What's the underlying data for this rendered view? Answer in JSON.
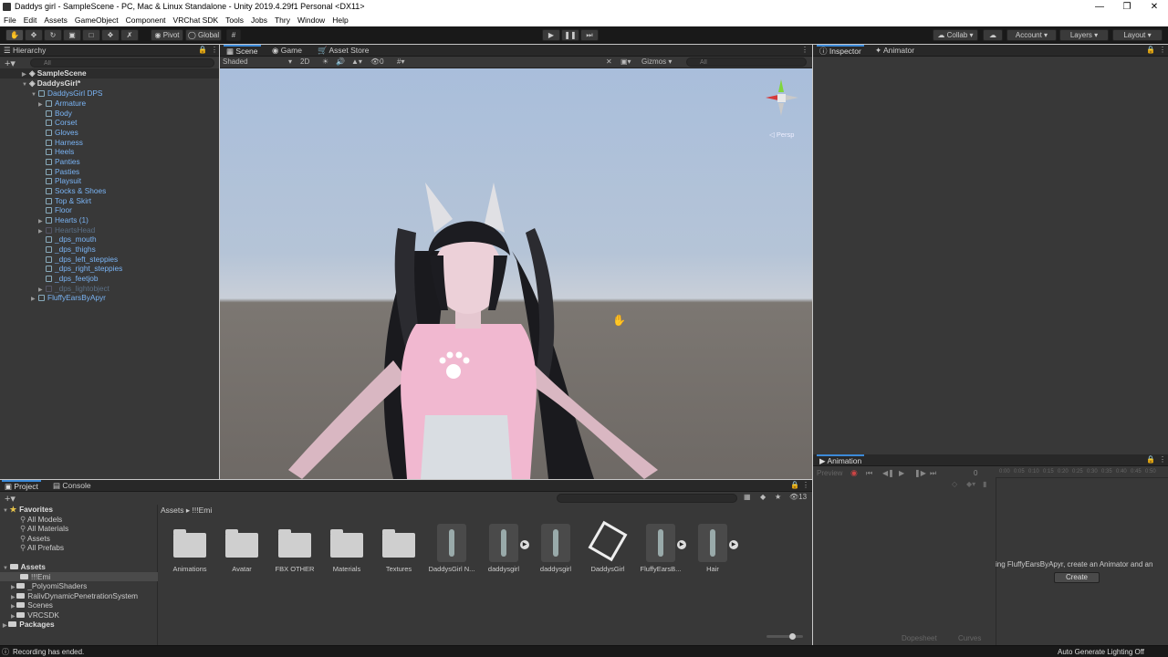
{
  "titlebar": {
    "title": "Daddys girl - SampleScene - PC, Mac & Linux Standalone - Unity 2019.4.29f1 Personal <DX11>"
  },
  "menu": [
    "File",
    "Edit",
    "Assets",
    "GameObject",
    "Component",
    "VRChat SDK",
    "Tools",
    "Jobs",
    "Thry",
    "Window",
    "Help"
  ],
  "toolbar": {
    "pivot": "Pivot",
    "global": "Global",
    "collab": "Collab",
    "account": "Account",
    "layers": "Layers",
    "layout": "Layout"
  },
  "hierarchy": {
    "tab": "Hierarchy",
    "search_placeholder": "All",
    "items": [
      {
        "label": "SampleScene",
        "type": "scene"
      },
      {
        "label": "DaddysGirl*",
        "type": "scene"
      },
      {
        "label": "DaddysGirl DPS",
        "type": "obj"
      },
      {
        "label": "Armature",
        "type": "obj"
      },
      {
        "label": "Body",
        "type": "obj"
      },
      {
        "label": "Corset",
        "type": "obj"
      },
      {
        "label": "Gloves",
        "type": "obj"
      },
      {
        "label": "Harness",
        "type": "obj"
      },
      {
        "label": "Heels",
        "type": "obj"
      },
      {
        "label": "Panties",
        "type": "obj"
      },
      {
        "label": "Pasties",
        "type": "obj"
      },
      {
        "label": "Playsuit",
        "type": "obj"
      },
      {
        "label": "Socks & Shoes",
        "type": "obj"
      },
      {
        "label": "Top & Skirt",
        "type": "obj"
      },
      {
        "label": "Floor",
        "type": "obj"
      },
      {
        "label": "Hearts (1)",
        "type": "obj"
      },
      {
        "label": "HeartsHead",
        "type": "dim"
      },
      {
        "label": "_dps_mouth",
        "type": "obj"
      },
      {
        "label": "_dps_thighs",
        "type": "obj"
      },
      {
        "label": "_dps_left_steppies",
        "type": "obj"
      },
      {
        "label": "_dps_right_steppies",
        "type": "obj"
      },
      {
        "label": "_dps_feetjob",
        "type": "obj"
      },
      {
        "label": "_dps_lightobject",
        "type": "dim"
      },
      {
        "label": "FluffyEarsByApyr",
        "type": "obj"
      }
    ]
  },
  "scene": {
    "tabs": [
      "Scene",
      "Game",
      "Asset Store"
    ],
    "shading": "Shaded",
    "mode2d": "2D",
    "fx_count": "0",
    "gizmos": "Gizmos",
    "search_placeholder": "All",
    "persp": "Persp"
  },
  "inspector": {
    "tabs": [
      "Inspector",
      "Animator"
    ]
  },
  "animation": {
    "tab": "Animation",
    "preview": "Preview",
    "frame": "0",
    "ticks": [
      "0:00",
      "0:05",
      "0:10",
      "0:15",
      "0:20",
      "0:25",
      "0:30",
      "0:35",
      "0:40",
      "0:45",
      "0:50",
      "0:55"
    ],
    "message": "ing FluffyEarsByApyr, create an Animator and an",
    "create": "Create",
    "dopesheet": "Dopesheet",
    "curves": "Curves"
  },
  "project": {
    "tabs": [
      "Project",
      "Console"
    ],
    "hidden_count": "13",
    "breadcrumb": [
      "Assets",
      "!!!Emi"
    ],
    "favorites_label": "Favorites",
    "favorites": [
      "All Models",
      "All Materials",
      "Assets",
      "All Prefabs"
    ],
    "assets_label": "Assets",
    "folders": [
      "!!!Emi",
      "_PolyomiShaders",
      "RalivDynamicPenetrationSystem",
      "Scenes",
      "VRCSDK"
    ],
    "packages_label": "Packages",
    "grid": [
      {
        "label": "Animations",
        "kind": "folder"
      },
      {
        "label": "Avatar",
        "kind": "folder"
      },
      {
        "label": "FBX OTHER",
        "kind": "folder"
      },
      {
        "label": "Materials",
        "kind": "folder"
      },
      {
        "label": "Textures",
        "kind": "folder"
      },
      {
        "label": "DaddysGirl N...",
        "kind": "model"
      },
      {
        "label": "daddysgirl",
        "kind": "model"
      },
      {
        "label": "daddysgirl",
        "kind": "model"
      },
      {
        "label": "DaddysGirl",
        "kind": "unity"
      },
      {
        "label": "FluffyEarsB...",
        "kind": "model"
      },
      {
        "label": "Hair",
        "kind": "model"
      }
    ]
  },
  "status": {
    "left": "Recording has ended.",
    "right": "Auto Generate Lighting Off"
  }
}
